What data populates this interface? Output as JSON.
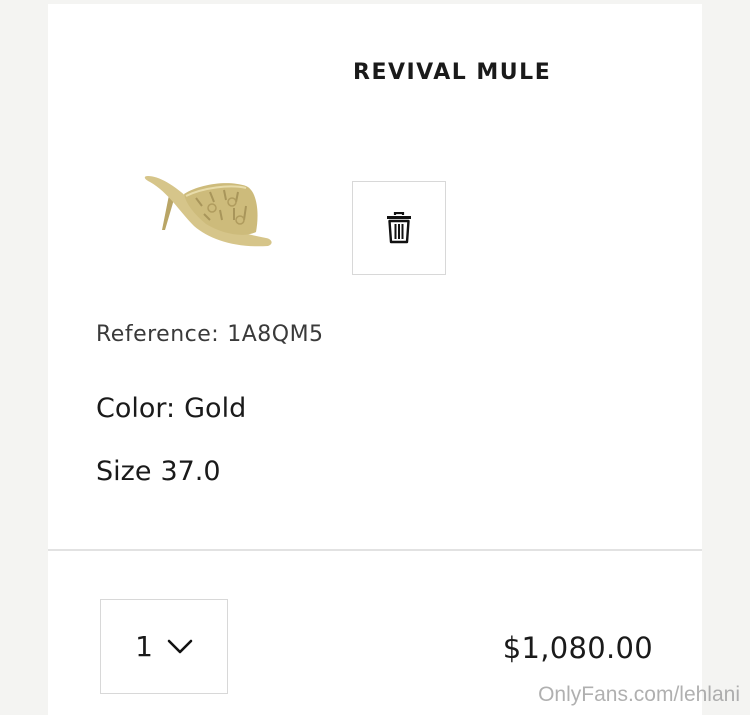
{
  "product": {
    "name": "REVIVAL MULE",
    "image_alt": "gold-mule-sandal",
    "reference_label": "Reference:",
    "reference_value": "1A8QM5",
    "color_label": "Color:",
    "color_value": "Gold",
    "size_label": "Size",
    "size_value": "37.0"
  },
  "cart_item": {
    "quantity": "1",
    "price": "$1,080.00",
    "delete_icon": "trash-icon",
    "dropdown_icon": "chevron-down-icon"
  },
  "watermark": {
    "text": "OnlyFans.com/lehlani"
  },
  "colors": {
    "background": "#f4f4f2",
    "card": "#ffffff",
    "text": "#1a1a1a",
    "border": "#d8d8d8",
    "divider": "#e2e2e2",
    "product_gold": "#c9b778"
  }
}
